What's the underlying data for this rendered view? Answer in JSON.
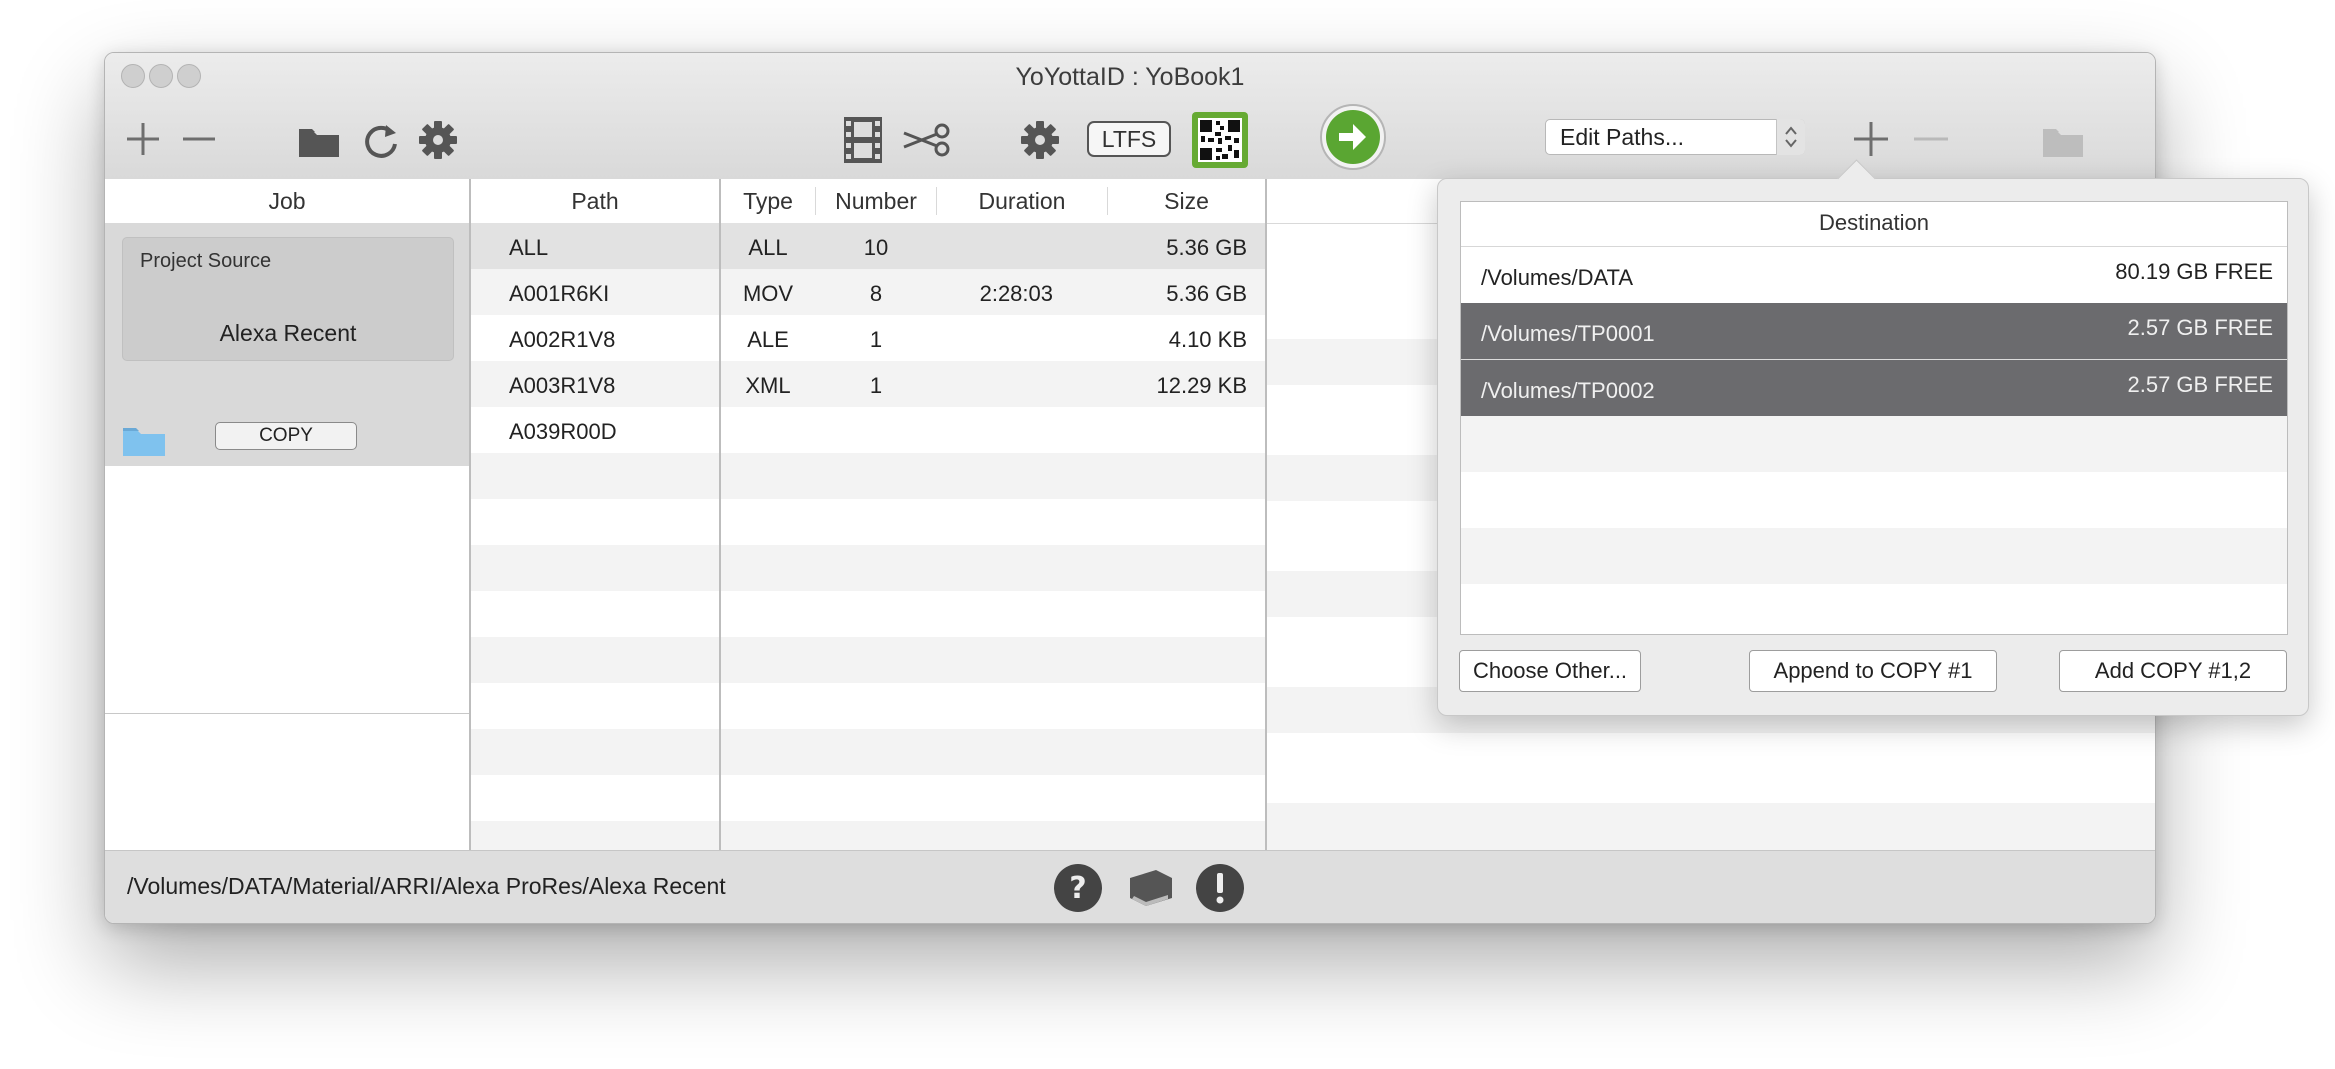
{
  "window": {
    "title": "YoYottaID : YoBook1"
  },
  "toolbar": {
    "ltfs_label": "LTFS",
    "edit_paths_select": "Edit Paths..."
  },
  "job": {
    "header": "Job",
    "card_label": "Project Source",
    "card_value": "Alexa Recent",
    "copy_button": "COPY"
  },
  "path_column": {
    "header": "Path",
    "items": [
      "ALL",
      "A001R6KI",
      "A002R1V8",
      "A003R1V8",
      "A039R00D"
    ]
  },
  "files": {
    "headers": {
      "type": "Type",
      "number": "Number",
      "duration": "Duration",
      "size": "Size"
    },
    "rows": [
      {
        "type": "ALL",
        "number": "10",
        "duration": "",
        "size": "5.36 GB"
      },
      {
        "type": "MOV",
        "number": "8",
        "duration": "2:28:03",
        "size": "5.36 GB"
      },
      {
        "type": "ALE",
        "number": "1",
        "duration": "",
        "size": "4.10 KB"
      },
      {
        "type": "XML",
        "number": "1",
        "duration": "",
        "size": "12.29 KB"
      }
    ]
  },
  "status": {
    "path": "/Volumes/DATA/Material/ARRI/Alexa ProRes/Alexa Recent"
  },
  "popover": {
    "header": "Destination",
    "rows": [
      {
        "path": "/Volumes/DATA",
        "free": "80.19 GB FREE",
        "selected": false
      },
      {
        "path": "/Volumes/TP0001",
        "free": "2.57 GB FREE",
        "selected": true
      },
      {
        "path": "/Volumes/TP0002",
        "free": "2.57 GB FREE",
        "selected": true
      }
    ],
    "buttons": {
      "choose_other": "Choose Other...",
      "append": "Append to COPY #1",
      "add_copy": "Add COPY #1,2"
    }
  },
  "colors": {
    "go_green": "#5aa632",
    "qr_green": "#66aa33",
    "selected_row": "#6b6b6e",
    "folder_blue": "#7fc2ee"
  }
}
